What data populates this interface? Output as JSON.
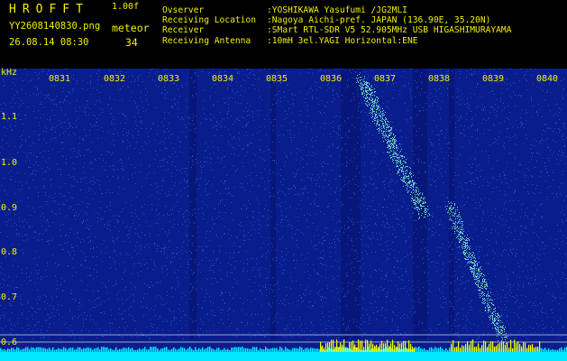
{
  "header": {
    "logo": "HROFFT",
    "version": "1.00f",
    "filename": "YY2608140830.png",
    "datetime": "26.08.14 08:30",
    "meteor_label": "meteor",
    "meteor_count": "34",
    "info": [
      {
        "key": "Ovserver",
        "value": ":YOSHIKAWA Yasufumi /JG2MLI"
      },
      {
        "key": "Receiving Location",
        "value": ":Nagoya Aichi-pref. JAPAN (136.90E, 35.20N)"
      },
      {
        "key": "Receiver",
        "value": ":SMart RTL-SDR V5 52.905MHz USB HIGASHIMURAYAMA"
      },
      {
        "key": "Receiving Antenna",
        "value": ":10mH 3el.YAGI Horizontal:ENE"
      }
    ]
  },
  "plot": {
    "y_unit": "kHz",
    "y_ticks": [
      "1.1",
      "1.0",
      "0.9",
      "0.8",
      "0.7",
      "0.6"
    ],
    "x_ticks": [
      "0831",
      "0832",
      "0833",
      "0834",
      "0835",
      "0836",
      "0837",
      "0838",
      "0839",
      "0840"
    ],
    "colors": {
      "background": "#0a1d8c",
      "noise": "#2b7cff",
      "strong": "#7ff0c0",
      "baseline": "#00e8ff",
      "marker": "#ffff00"
    }
  }
}
